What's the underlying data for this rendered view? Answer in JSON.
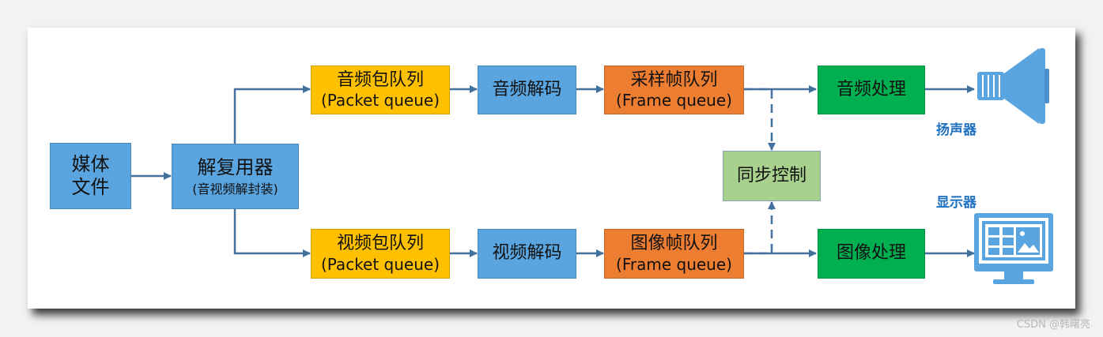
{
  "nodes": {
    "media_file": {
      "line1": "媒体",
      "line2": "文件"
    },
    "demuxer": {
      "title": "解复用器",
      "subtitle": "(音视频解封装)"
    },
    "audio_packet_queue": {
      "title": "音频包队列",
      "subtitle": "(Packet queue)"
    },
    "audio_decode": {
      "title": "音频解码"
    },
    "sample_frame_queue": {
      "title": "采样帧队列",
      "subtitle": "(Frame queue)"
    },
    "audio_process": {
      "title": "音频处理"
    },
    "video_packet_queue": {
      "title": "视频包队列",
      "subtitle": "(Packet queue)"
    },
    "video_decode": {
      "title": "视频解码"
    },
    "image_frame_queue": {
      "title": "图像帧队列",
      "subtitle": "(Frame queue)"
    },
    "image_process": {
      "title": "图像处理"
    },
    "sync_control": {
      "title": "同步控制"
    }
  },
  "outputs": {
    "speaker_label": "扬声器",
    "display_label": "显示器",
    "speaker_icon": "megaphone-icon",
    "display_icon": "monitor-icon"
  },
  "watermark": "CSDN @韩曙亮",
  "colors": {
    "blue": "#5aa5df",
    "yellow": "#ffc000",
    "orange": "#ed7d31",
    "green": "#00b050",
    "light_green": "#a9d18e",
    "arrow": "#41719c",
    "caption": "#1f70c1"
  }
}
